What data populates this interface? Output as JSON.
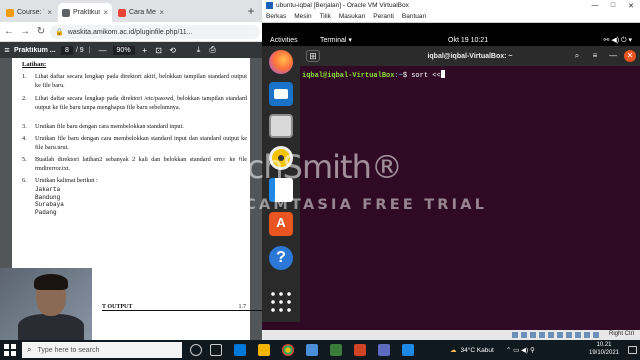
{
  "browser": {
    "tabs": [
      {
        "label": "Course: Th",
        "favicon_color": "#f39c12"
      },
      {
        "label": "Praktikum",
        "favicon_color": "#5f6368",
        "active": true
      },
      {
        "label": "Cara Mem",
        "favicon_color": "#ea4335"
      }
    ],
    "new_tab": "+",
    "url": "waskita.amikom.ac.id/pluginfile.php/11...",
    "pdf": {
      "title": "Praktikum ...",
      "page_current": "8",
      "page_total": "/ 9",
      "zoom": "90%",
      "heading": "Latihan:",
      "items": [
        {
          "num": "1.",
          "text": "Lihat daftar secara lengkap pada direktori aktif, belokkan tampilan standard output ke file baru."
        },
        {
          "num": "2.",
          "text": "Lihat daftar secara lengkap pada direktori /etc/passwd, belokkan tampilan standard output ke file baru tanpa menghapus file baru sebelumnya."
        },
        {
          "num": "3.",
          "text": "Urutkan file baru dengan cara membelokkan standard input."
        },
        {
          "num": "4.",
          "text": "Urutkan file baru dengan cara membelokkan standard input dan standard output ke file baru.urut."
        },
        {
          "num": "5.",
          "text": "Buatlah direktori latihan2 sebanyak 2 kali dan belokkan standard error ke file rmdirerror.txt."
        },
        {
          "num": "6.",
          "text": "Urutkan kalimat berikut :"
        }
      ],
      "fruits": [
        "Jakarta",
        "Bandung",
        "Surabaya",
        "Padang"
      ],
      "footer_label": "T OUTPUT",
      "footer_page": "1.7"
    }
  },
  "vbox": {
    "window_title": "ubuntu-iqbal [Berjalan] - Oracle VM VirtualBox",
    "menu": [
      "Berkas",
      "Mesin",
      "Tilik",
      "Masukan",
      "Peranti",
      "Bantuan"
    ],
    "gnome": {
      "activities": "Activities",
      "app": "Terminal ▾",
      "clock": "Okt 19  10:21"
    },
    "terminal": {
      "title": "iqbal@iqbal-VirtualBox: ~",
      "prompt_user": "iqbal@iqbal-VirtualBox",
      "prompt_path": ":~",
      "prompt_sym": "$ ",
      "command": "sort <<"
    },
    "status_right": "Right Ctrl"
  },
  "watermark": {
    "logo": "TechSmith®",
    "text": "MADE WITH CAMTASIA FREE TRIAL"
  },
  "taskbar": {
    "search_placeholder": "Type here to search",
    "weather": "34°C  Kabut",
    "time": "10.21",
    "date": "19/10/2021"
  }
}
